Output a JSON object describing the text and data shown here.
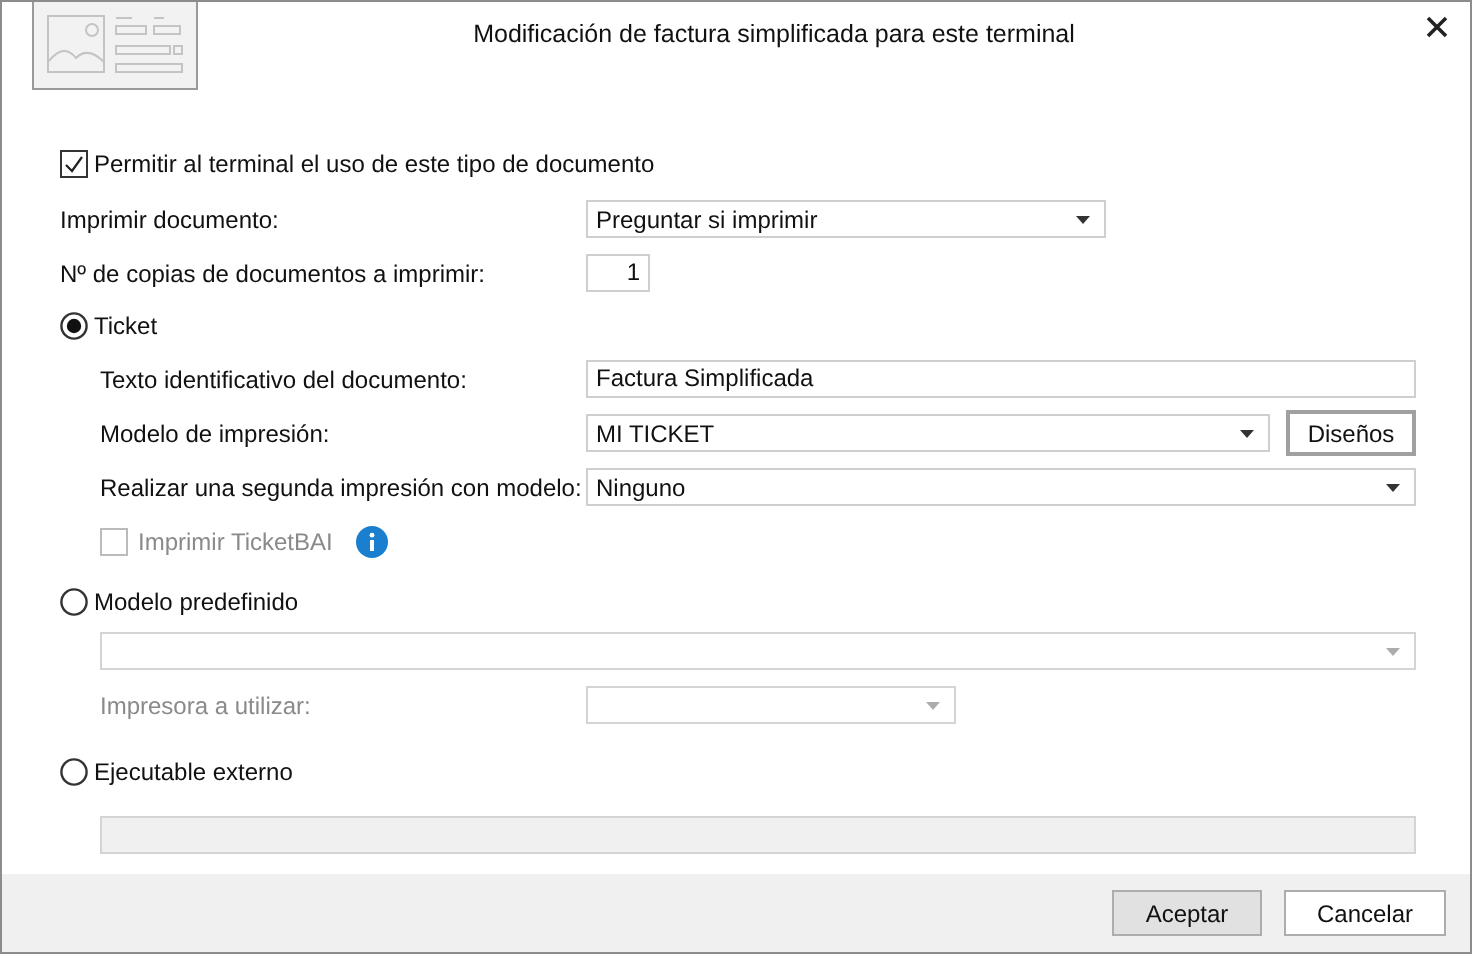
{
  "window": {
    "title": "Modificación de factura simplificada para este terminal"
  },
  "allow": {
    "label": "Permitir al terminal el uso de este tipo de documento",
    "checked": true
  },
  "print_document": {
    "label": "Imprimir documento:",
    "value": "Preguntar si imprimir"
  },
  "copies": {
    "label": "Nº de copias de documentos a imprimir:",
    "value": "1"
  },
  "ticket": {
    "label": "Ticket",
    "selected": true,
    "fields": [
      {
        "kind": "text",
        "label": "Texto identificativo del documento:",
        "value": "Factura Simplificada"
      },
      {
        "kind": "select_button",
        "label": "Modelo de impresión:",
        "value": "MI TICKET",
        "button": "Diseños"
      },
      {
        "kind": "select",
        "label": "Realizar una segunda impresión con modelo:",
        "value": "Ninguno"
      }
    ],
    "ticketbai": {
      "label": "Imprimir TicketBAI",
      "checked": false,
      "disabled": true
    }
  },
  "predefined": {
    "label": "Modelo predefinido",
    "selected": false,
    "printer_label": "Impresora a utilizar:"
  },
  "external": {
    "label": "Ejecutable externo",
    "selected": false
  },
  "buttons": [
    {
      "label": "Aceptar",
      "default": true
    },
    {
      "label": "Cancelar",
      "default": false
    }
  ]
}
